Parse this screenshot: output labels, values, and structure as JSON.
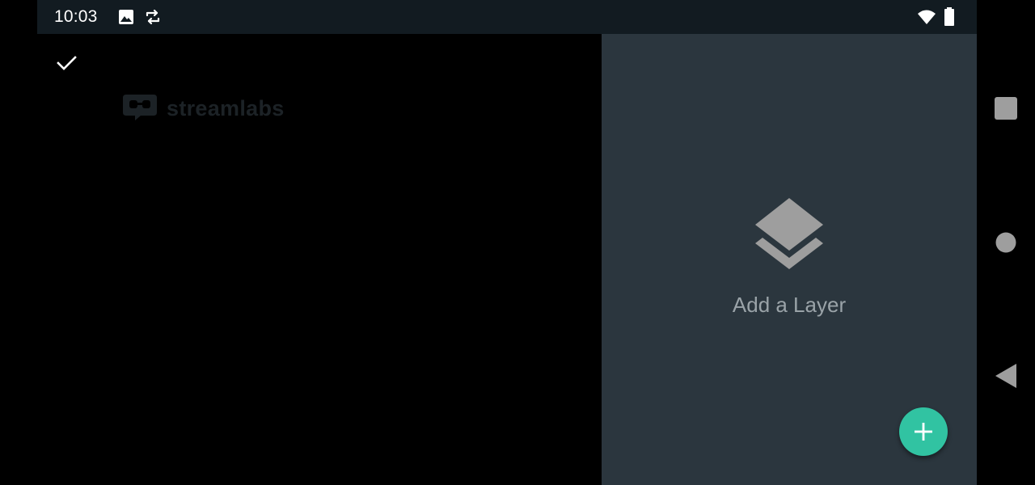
{
  "status_bar": {
    "time": "10:03",
    "icons": [
      "image-icon",
      "sync-icon",
      "wifi-icon",
      "battery-icon"
    ]
  },
  "preview": {
    "confirm_icon": "check-icon",
    "watermark": {
      "icon": "streamlabs-logo-icon",
      "text": "streamlabs"
    }
  },
  "layers_panel": {
    "empty_icon": "layers-icon",
    "empty_label": "Add a Layer",
    "fab_icon": "plus-icon"
  },
  "nav_bar": {
    "buttons": [
      "recents-square-icon",
      "home-circle-icon",
      "back-triangle-icon"
    ]
  },
  "colors": {
    "status_bar_bg": "#121b21",
    "panel_bg": "#2b363e",
    "accent": "#31c3a2",
    "label": "#9aa3a8",
    "nav_icon": "#9e9e9e"
  }
}
